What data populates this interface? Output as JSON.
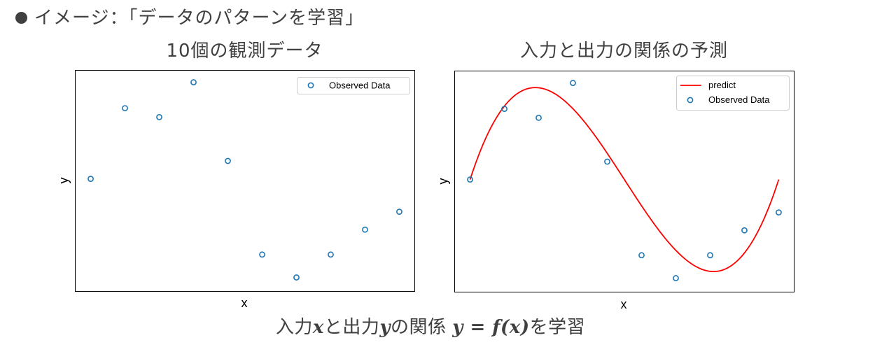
{
  "headline": "イメージ：「データのパターンを学習」",
  "caption": {
    "part1": "入力",
    "x": "x",
    "part2": "と出力",
    "y": "y",
    "part3": "の関係 ",
    "formula": "y = f(x)",
    "part4": "を学習"
  },
  "colors": {
    "text": "#404040",
    "observed": "#1f77b4",
    "predict": "#ff0000",
    "axes": "#000000"
  },
  "chart_data": [
    {
      "type": "scatter",
      "title": "10個の観測データ",
      "xlabel": "x",
      "ylabel": "y",
      "xlim": [
        -0.05,
        1.05
      ],
      "ylim": [
        -1.13,
        1.09
      ],
      "grid": false,
      "ticks": false,
      "legend": {
        "placement": "top-right",
        "entries": [
          "Observed Data"
        ]
      },
      "series": [
        {
          "name": "Observed Data",
          "type": "scatter",
          "marker": "open-circle",
          "x": [
            0.0,
            0.1111,
            0.2222,
            0.3333,
            0.4444,
            0.5556,
            0.6667,
            0.7778,
            0.8889,
            1.0
          ],
          "y": [
            0.0,
            0.71,
            0.62,
            0.97,
            0.18,
            -0.76,
            -0.99,
            -0.76,
            -0.51,
            -0.33
          ]
        }
      ]
    },
    {
      "type": "line",
      "title": "入力と出力の関係の予測",
      "xlabel": "x",
      "ylabel": "y",
      "xlim": [
        -0.05,
        1.05
      ],
      "ylim": [
        -1.13,
        1.09
      ],
      "grid": false,
      "ticks": false,
      "legend": {
        "placement": "top-right",
        "entries": [
          "predict",
          "Observed Data"
        ]
      },
      "series": [
        {
          "name": "predict",
          "type": "line",
          "description": "cubic polynomial fit, y = 19.2(x-0.5)^3 - 4.8(x-0.5)",
          "x_range": [
            0.0,
            1.0
          ],
          "coefficients_centered_at_0_5": {
            "cubic": 19.2,
            "linear": -4.8
          }
        },
        {
          "name": "Observed Data",
          "type": "scatter",
          "marker": "open-circle",
          "x": [
            0.0,
            0.1111,
            0.2222,
            0.3333,
            0.4444,
            0.5556,
            0.6667,
            0.7778,
            0.8889,
            1.0
          ],
          "y": [
            0.0,
            0.71,
            0.62,
            0.97,
            0.18,
            -0.76,
            -0.99,
            -0.76,
            -0.51,
            -0.33
          ]
        }
      ]
    }
  ]
}
